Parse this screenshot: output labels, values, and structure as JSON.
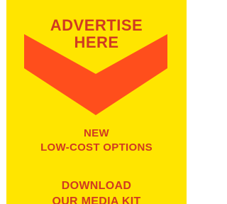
{
  "ad": {
    "headline_line1": "ADVERTISE",
    "headline_line2": "HERE",
    "offer_line1": "NEW",
    "offer_line2": "LOW-COST OPTIONS",
    "cta_line1": "DOWNLOAD",
    "cta_line2": "OUR MEDIA KIT"
  },
  "colors": {
    "background": "#FFE500",
    "text": "#D03A21",
    "chevron": "#FF4E1C"
  },
  "icons": {
    "chevron": "chevron-down-icon"
  }
}
